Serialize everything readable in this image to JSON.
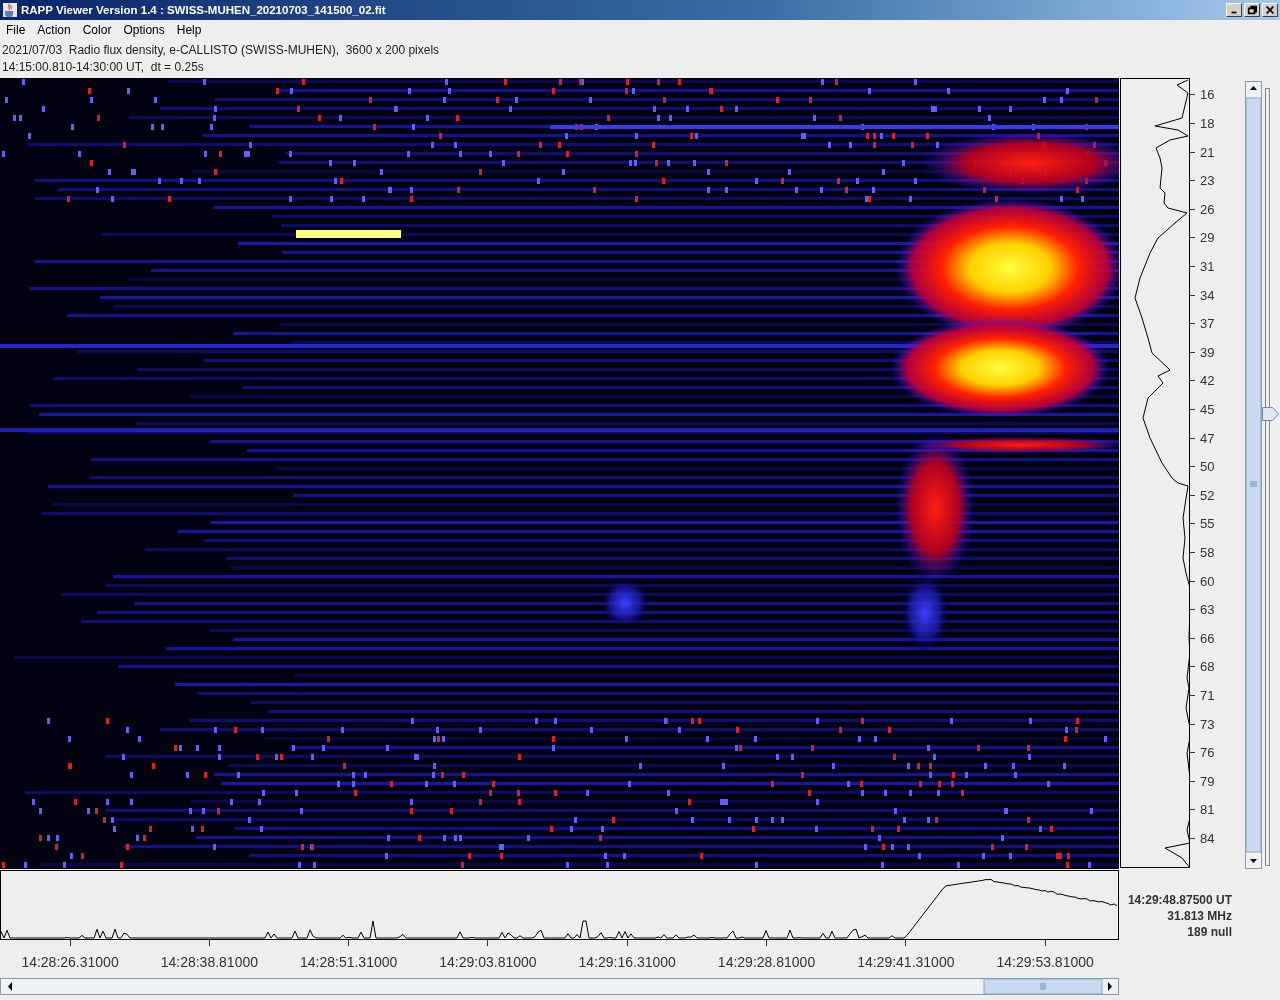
{
  "window": {
    "title": "RAPP Viewer Version 1.4 : SWISS-MUHEN_20210703_141500_02.fit"
  },
  "menu": [
    "File",
    "Action",
    "Color",
    "Options",
    "Help"
  ],
  "header": {
    "line_1": "2021/07/03  Radio flux density, e-CALLISTO (SWISS-MUHEN),  3600 x 200 pixels",
    "line_2": "14:15:00.810-14:30:00 UT,  dt = 0.25s"
  },
  "frequency_axis": {
    "ticks": [
      "16",
      "18",
      "21",
      "23",
      "26",
      "29",
      "31",
      "34",
      "37",
      "39",
      "42",
      "45",
      "47",
      "50",
      "52",
      "55",
      "58",
      "60",
      "63",
      "66",
      "68",
      "71",
      "73",
      "76",
      "79",
      "81",
      "84"
    ]
  },
  "time_axis": {
    "ticks": [
      "14:28:26.31000",
      "14:28:38.81000",
      "14:28:51.31000",
      "14:29:03.81000",
      "14:29:16.31000",
      "14:29:28.81000",
      "14:29:41.31000",
      "14:29:53.81000"
    ]
  },
  "readout": {
    "time": "14:29:48.87500 UT",
    "frequency": "31.813 MHz",
    "value": "189 null"
  },
  "side_slider": {
    "level": 0.58
  }
}
